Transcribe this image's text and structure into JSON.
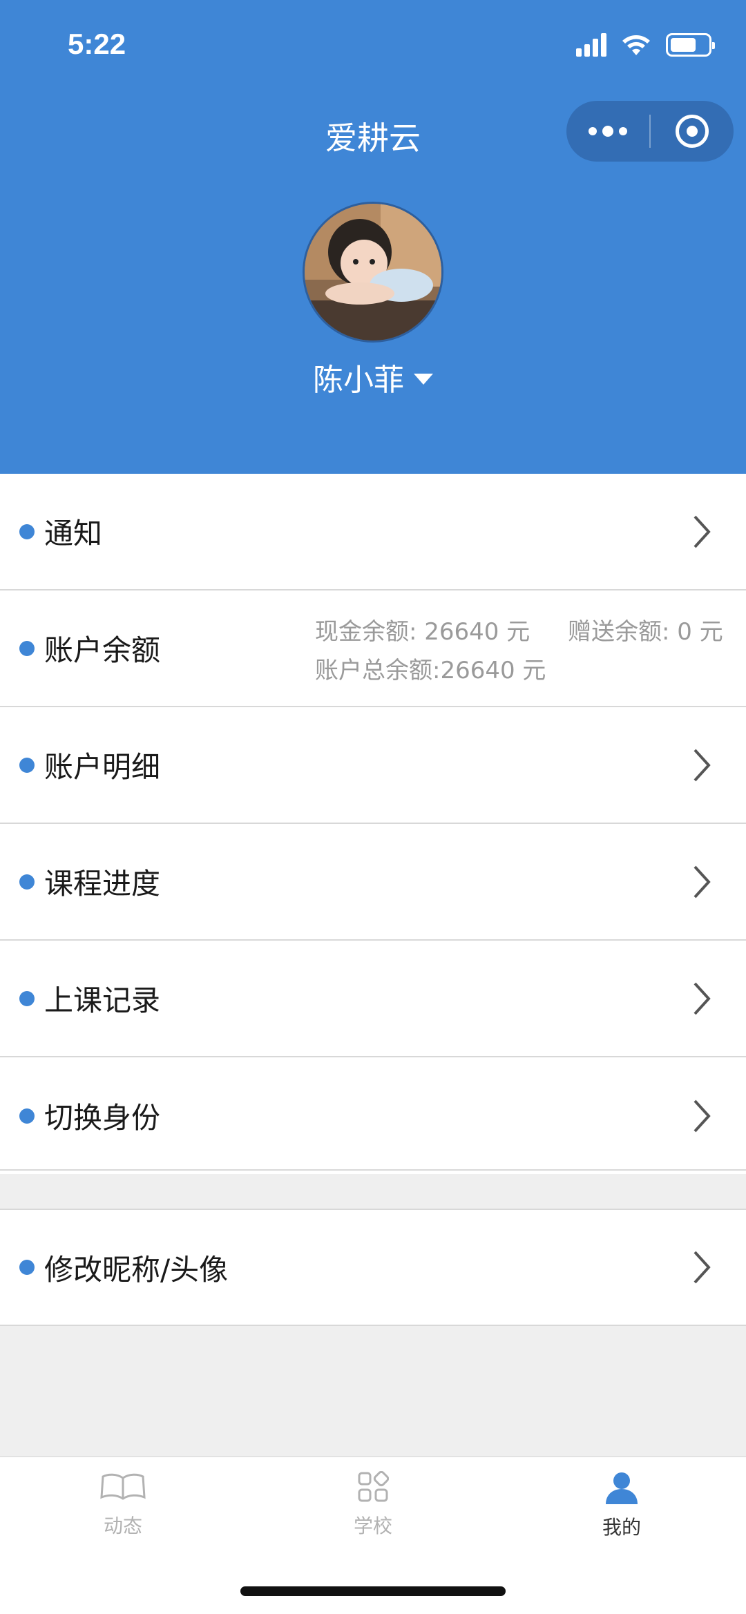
{
  "status_bar": {
    "time": "5:22"
  },
  "header": {
    "title": "爱耕云",
    "username": "陈小菲"
  },
  "menu": {
    "notice": "通知",
    "balance_label": "账户余额",
    "balance_cash": "现金余额: 26640 元",
    "balance_gift": "赠送余额: 0 元",
    "balance_total": "账户总余额:26640 元",
    "details": "账户明细",
    "progress": "课程进度",
    "records": "上课记录",
    "switch": "切换身份",
    "edit_profile": "修改昵称/头像"
  },
  "tabs": [
    {
      "label": "动态",
      "icon": "book-icon",
      "active": false
    },
    {
      "label": "学校",
      "icon": "grid-icon",
      "active": false
    },
    {
      "label": "我的",
      "icon": "person-icon",
      "active": true
    }
  ],
  "colors": {
    "primary": "#3f86d6",
    "capsule": "#336db4"
  }
}
